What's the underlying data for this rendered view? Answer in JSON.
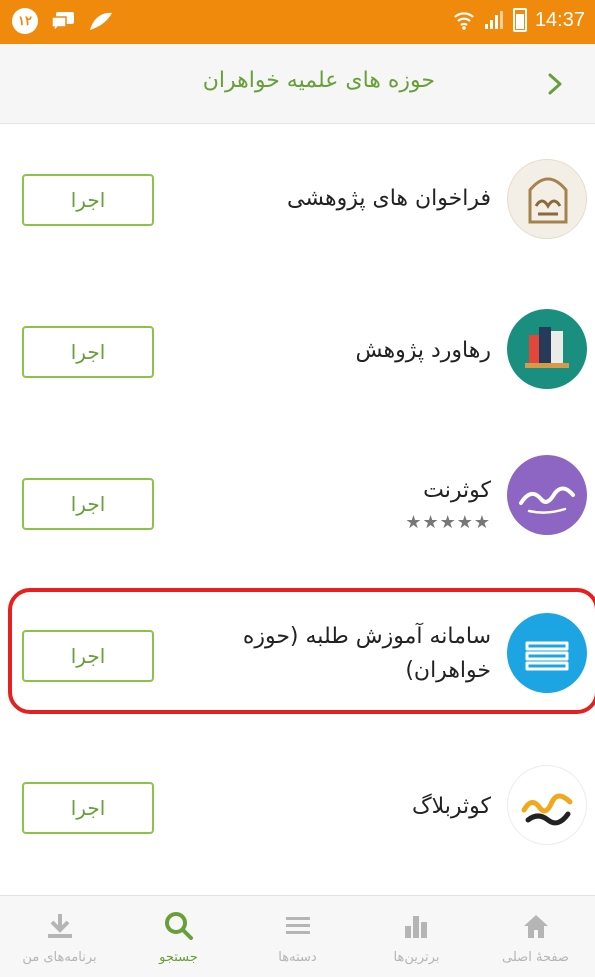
{
  "status_bar": {
    "badge_text": "۱۲",
    "time": "14:37"
  },
  "header": {
    "title": "حوزه های علمیه خواهران"
  },
  "apps": [
    {
      "name": "فراخوان های پژوهشی",
      "button": "اجرا",
      "icon": "farakhan-logo-icon"
    },
    {
      "name": "رهاورد پژوهش",
      "button": "اجرا",
      "icon": "books-shelf-icon"
    },
    {
      "name": "کوثرنت",
      "button": "اجرا",
      "icon": "kowsarnet-logo-icon",
      "stars": "★★★★★",
      "rating": 4.5
    },
    {
      "name": "سامانه آموزش طلبه (حوزه خواهران)",
      "button": "اجرا",
      "icon": "stacked-books-icon"
    },
    {
      "name": "کوثربلاگ",
      "button": "اجرا",
      "icon": "kowsarblog-logo-icon"
    }
  ],
  "bottom_nav": [
    {
      "label": "برنامه‌های من",
      "icon": "download-icon"
    },
    {
      "label": "جستجو",
      "icon": "search-icon",
      "active": true
    },
    {
      "label": "دسته‌ها",
      "icon": "list-icon"
    },
    {
      "label": "برترین‌ها",
      "icon": "bar-chart-icon"
    },
    {
      "label": "صفحهٔ اصلی",
      "icon": "home-icon"
    }
  ],
  "colors": {
    "status_bar": "#f08a0c",
    "accent": "#689f38",
    "button_border": "#8bc34a",
    "highlight": "#e81f1f"
  }
}
